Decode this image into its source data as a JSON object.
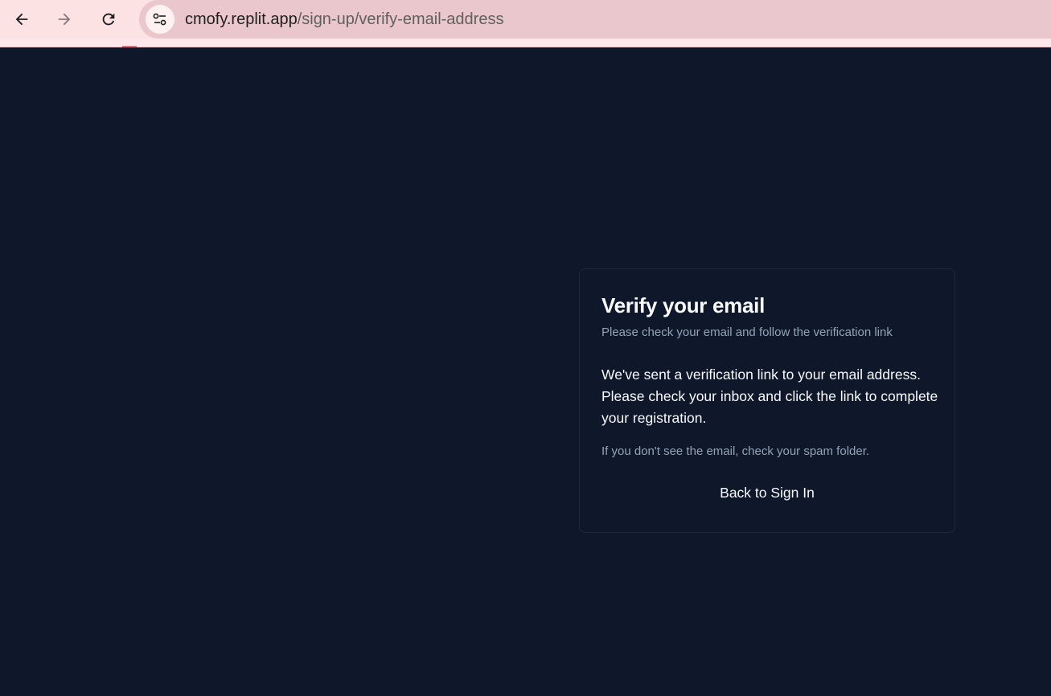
{
  "browser": {
    "url_host": "cmofy.replit.app",
    "url_path": "/sign-up/verify-email-address",
    "icons": {
      "back": "arrow-left-icon",
      "forward": "arrow-right-icon",
      "reload": "reload-icon",
      "site_info": "tune-icon"
    }
  },
  "card": {
    "title": "Verify your email",
    "subtitle": "Please check your email and follow the verification link",
    "message": "We've sent a verification link to your email address. Please check your inbox and click the link to complete your registration.",
    "hint": "If you don't see the email, check your spam folder.",
    "back_link": "Back to Sign In"
  },
  "colors": {
    "background": "#0f172a",
    "card_border": "#1e293b",
    "text_primary": "#f8fafc",
    "text_muted": "#94a3b8",
    "chrome": "#fde2e4"
  }
}
